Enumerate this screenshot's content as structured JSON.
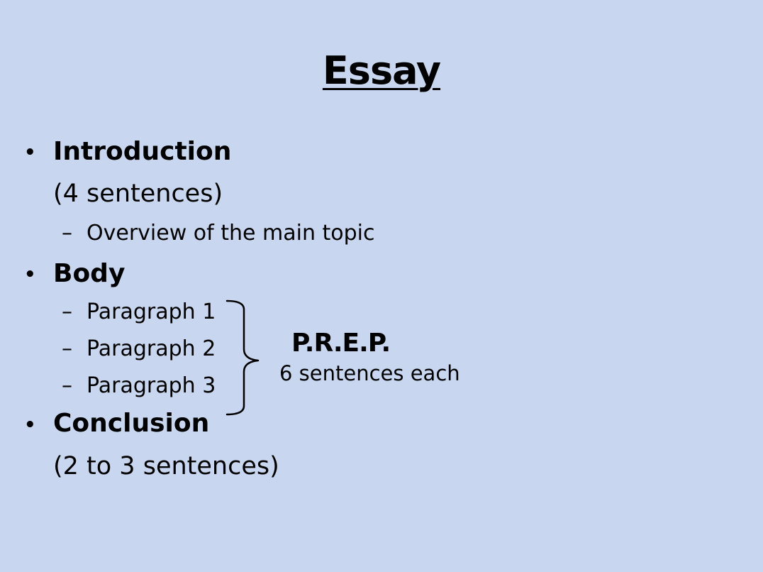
{
  "slide": {
    "title": "Essay",
    "items": [
      {
        "heading": "Introduction",
        "detail": "(4 sentences)",
        "subitems": [
          "Overview of the main topic"
        ]
      },
      {
        "heading": "Body",
        "subitems": [
          "Paragraph 1",
          "Paragraph 2",
          "Paragraph 3"
        ]
      },
      {
        "heading": "Conclusion",
        "detail": "(2 to 3 sentences)"
      }
    ],
    "bracket_note": {
      "label": "P.R.E.P.",
      "detail": "6 sentences each"
    },
    "colors": {
      "background": "#c9d6ef",
      "text": "#000000"
    }
  }
}
